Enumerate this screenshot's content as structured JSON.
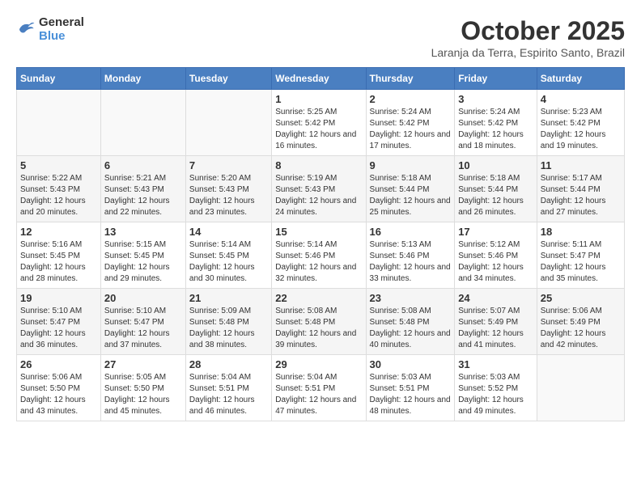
{
  "header": {
    "logo": {
      "general": "General",
      "blue": "Blue"
    },
    "title": "October 2025",
    "location": "Laranja da Terra, Espirito Santo, Brazil"
  },
  "calendar": {
    "weekdays": [
      "Sunday",
      "Monday",
      "Tuesday",
      "Wednesday",
      "Thursday",
      "Friday",
      "Saturday"
    ],
    "weeks": [
      [
        {
          "day": "",
          "sunrise": "",
          "sunset": "",
          "daylight": ""
        },
        {
          "day": "",
          "sunrise": "",
          "sunset": "",
          "daylight": ""
        },
        {
          "day": "",
          "sunrise": "",
          "sunset": "",
          "daylight": ""
        },
        {
          "day": "1",
          "sunrise": "Sunrise: 5:25 AM",
          "sunset": "Sunset: 5:42 PM",
          "daylight": "Daylight: 12 hours and 16 minutes."
        },
        {
          "day": "2",
          "sunrise": "Sunrise: 5:24 AM",
          "sunset": "Sunset: 5:42 PM",
          "daylight": "Daylight: 12 hours and 17 minutes."
        },
        {
          "day": "3",
          "sunrise": "Sunrise: 5:24 AM",
          "sunset": "Sunset: 5:42 PM",
          "daylight": "Daylight: 12 hours and 18 minutes."
        },
        {
          "day": "4",
          "sunrise": "Sunrise: 5:23 AM",
          "sunset": "Sunset: 5:42 PM",
          "daylight": "Daylight: 12 hours and 19 minutes."
        }
      ],
      [
        {
          "day": "5",
          "sunrise": "Sunrise: 5:22 AM",
          "sunset": "Sunset: 5:43 PM",
          "daylight": "Daylight: 12 hours and 20 minutes."
        },
        {
          "day": "6",
          "sunrise": "Sunrise: 5:21 AM",
          "sunset": "Sunset: 5:43 PM",
          "daylight": "Daylight: 12 hours and 22 minutes."
        },
        {
          "day": "7",
          "sunrise": "Sunrise: 5:20 AM",
          "sunset": "Sunset: 5:43 PM",
          "daylight": "Daylight: 12 hours and 23 minutes."
        },
        {
          "day": "8",
          "sunrise": "Sunrise: 5:19 AM",
          "sunset": "Sunset: 5:43 PM",
          "daylight": "Daylight: 12 hours and 24 minutes."
        },
        {
          "day": "9",
          "sunrise": "Sunrise: 5:18 AM",
          "sunset": "Sunset: 5:44 PM",
          "daylight": "Daylight: 12 hours and 25 minutes."
        },
        {
          "day": "10",
          "sunrise": "Sunrise: 5:18 AM",
          "sunset": "Sunset: 5:44 PM",
          "daylight": "Daylight: 12 hours and 26 minutes."
        },
        {
          "day": "11",
          "sunrise": "Sunrise: 5:17 AM",
          "sunset": "Sunset: 5:44 PM",
          "daylight": "Daylight: 12 hours and 27 minutes."
        }
      ],
      [
        {
          "day": "12",
          "sunrise": "Sunrise: 5:16 AM",
          "sunset": "Sunset: 5:45 PM",
          "daylight": "Daylight: 12 hours and 28 minutes."
        },
        {
          "day": "13",
          "sunrise": "Sunrise: 5:15 AM",
          "sunset": "Sunset: 5:45 PM",
          "daylight": "Daylight: 12 hours and 29 minutes."
        },
        {
          "day": "14",
          "sunrise": "Sunrise: 5:14 AM",
          "sunset": "Sunset: 5:45 PM",
          "daylight": "Daylight: 12 hours and 30 minutes."
        },
        {
          "day": "15",
          "sunrise": "Sunrise: 5:14 AM",
          "sunset": "Sunset: 5:46 PM",
          "daylight": "Daylight: 12 hours and 32 minutes."
        },
        {
          "day": "16",
          "sunrise": "Sunrise: 5:13 AM",
          "sunset": "Sunset: 5:46 PM",
          "daylight": "Daylight: 12 hours and 33 minutes."
        },
        {
          "day": "17",
          "sunrise": "Sunrise: 5:12 AM",
          "sunset": "Sunset: 5:46 PM",
          "daylight": "Daylight: 12 hours and 34 minutes."
        },
        {
          "day": "18",
          "sunrise": "Sunrise: 5:11 AM",
          "sunset": "Sunset: 5:47 PM",
          "daylight": "Daylight: 12 hours and 35 minutes."
        }
      ],
      [
        {
          "day": "19",
          "sunrise": "Sunrise: 5:10 AM",
          "sunset": "Sunset: 5:47 PM",
          "daylight": "Daylight: 12 hours and 36 minutes."
        },
        {
          "day": "20",
          "sunrise": "Sunrise: 5:10 AM",
          "sunset": "Sunset: 5:47 PM",
          "daylight": "Daylight: 12 hours and 37 minutes."
        },
        {
          "day": "21",
          "sunrise": "Sunrise: 5:09 AM",
          "sunset": "Sunset: 5:48 PM",
          "daylight": "Daylight: 12 hours and 38 minutes."
        },
        {
          "day": "22",
          "sunrise": "Sunrise: 5:08 AM",
          "sunset": "Sunset: 5:48 PM",
          "daylight": "Daylight: 12 hours and 39 minutes."
        },
        {
          "day": "23",
          "sunrise": "Sunrise: 5:08 AM",
          "sunset": "Sunset: 5:48 PM",
          "daylight": "Daylight: 12 hours and 40 minutes."
        },
        {
          "day": "24",
          "sunrise": "Sunrise: 5:07 AM",
          "sunset": "Sunset: 5:49 PM",
          "daylight": "Daylight: 12 hours and 41 minutes."
        },
        {
          "day": "25",
          "sunrise": "Sunrise: 5:06 AM",
          "sunset": "Sunset: 5:49 PM",
          "daylight": "Daylight: 12 hours and 42 minutes."
        }
      ],
      [
        {
          "day": "26",
          "sunrise": "Sunrise: 5:06 AM",
          "sunset": "Sunset: 5:50 PM",
          "daylight": "Daylight: 12 hours and 43 minutes."
        },
        {
          "day": "27",
          "sunrise": "Sunrise: 5:05 AM",
          "sunset": "Sunset: 5:50 PM",
          "daylight": "Daylight: 12 hours and 45 minutes."
        },
        {
          "day": "28",
          "sunrise": "Sunrise: 5:04 AM",
          "sunset": "Sunset: 5:51 PM",
          "daylight": "Daylight: 12 hours and 46 minutes."
        },
        {
          "day": "29",
          "sunrise": "Sunrise: 5:04 AM",
          "sunset": "Sunset: 5:51 PM",
          "daylight": "Daylight: 12 hours and 47 minutes."
        },
        {
          "day": "30",
          "sunrise": "Sunrise: 5:03 AM",
          "sunset": "Sunset: 5:51 PM",
          "daylight": "Daylight: 12 hours and 48 minutes."
        },
        {
          "day": "31",
          "sunrise": "Sunrise: 5:03 AM",
          "sunset": "Sunset: 5:52 PM",
          "daylight": "Daylight: 12 hours and 49 minutes."
        },
        {
          "day": "",
          "sunrise": "",
          "sunset": "",
          "daylight": ""
        }
      ]
    ]
  }
}
